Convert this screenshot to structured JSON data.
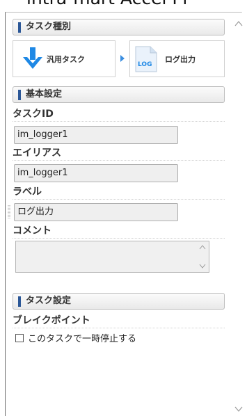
{
  "window": {
    "partial_title": "intra-mart Accel Pl"
  },
  "sections": {
    "task_type": {
      "title": "タスク種別",
      "source_task": {
        "label": "汎用タスク",
        "icon": "down-arrow-icon",
        "icon_color": "#1e88e5"
      },
      "target_task": {
        "label": "ログ出力",
        "icon": "log-file-icon",
        "icon_text": "LOG",
        "icon_color": "#1e88e5"
      }
    },
    "basic_settings": {
      "title": "基本設定",
      "task_id": {
        "label": "タスクID",
        "value": "im_logger1"
      },
      "alias": {
        "label": "エイリアス",
        "value": "im_logger1"
      },
      "label": {
        "label": "ラベル",
        "value": "ログ出力"
      },
      "comment": {
        "label": "コメント",
        "value": ""
      }
    },
    "task_settings": {
      "title": "タスク設定",
      "breakpoint": {
        "label": "ブレイクポイント",
        "checkbox_label": "このタスクで一時停止する",
        "checked": false
      }
    }
  },
  "colors": {
    "accent": "#2b5797",
    "icon_blue": "#1e88e5"
  }
}
